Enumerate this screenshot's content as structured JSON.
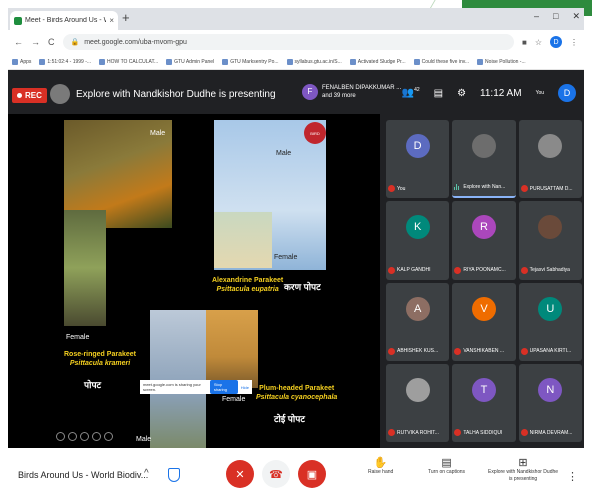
{
  "browser": {
    "tab_title": "Meet - Birds Around Us - W",
    "new_tab": "+",
    "window_controls": [
      "–",
      "□",
      "✕"
    ],
    "url": "meet.google.com/uba-mvom-gpu",
    "bookmarks": [
      "Apps",
      "1:51:02:4 - 1999 -...",
      "HOW TO CALCULAT...",
      "GTU Admin Panel",
      "GTU Marksentry Po...",
      "syllabus.gtu.ac.in/S...",
      "Activated Sludge Pr...",
      "Could these five inv...",
      "Noise Pollution -..."
    ]
  },
  "meet": {
    "rec_label": "REC",
    "presenting_text": "Explore with Nandkishor Dudhe is presenting",
    "others_avatar": "F",
    "others_line1": "FENALBEN DIPAKKUMAR ...",
    "others_line2": "and 39 more",
    "participant_count": "42",
    "time": "11:12 AM",
    "you_avatar": "D",
    "you_label": "You"
  },
  "slide": {
    "logo_text": "BIRD",
    "labels": {
      "male1": "Male",
      "female1": "Female",
      "male2": "Male",
      "female2": "Female",
      "female3": "Female",
      "male3": "Male"
    },
    "captions": {
      "rose_line1": "Rose-ringed Parakeet",
      "rose_line2": "Psittacula krameri",
      "rose_hindi": "पोपट",
      "alex_line1": "Alexandrine Parakeet",
      "alex_line2": "Psittacula eupatria",
      "alex_hindi": "करण पोपट",
      "plum_line1": "Plum-headed Parakeet",
      "plum_line2": "Psittacula cyanocephala",
      "plum_hindi": "टोई पोपट"
    },
    "share_bar": {
      "text": "meet.google.com is sharing your screen.",
      "stop": "Stop sharing",
      "hide": "Hide"
    }
  },
  "participants": [
    {
      "avatar": "D",
      "name": "You",
      "color": "#5c6bc0",
      "mic": "off"
    },
    {
      "avatar": "",
      "name": "Explore with Nan...",
      "color": "#6d6d6d",
      "mic": "on"
    },
    {
      "avatar": "",
      "name": "PURUSATTAM D...",
      "color": "#8a8a8a",
      "mic": "off"
    },
    {
      "avatar": "K",
      "name": "KALP GANDHI",
      "color": "#00897b",
      "mic": "off"
    },
    {
      "avatar": "R",
      "name": "RIYA POONAMC...",
      "color": "#ab47bc",
      "mic": "off"
    },
    {
      "avatar": "",
      "name": "Tejasvi Sabhadiya",
      "color": "#6a4a3a",
      "mic": "off"
    },
    {
      "avatar": "A",
      "name": "ABHISHEK KUS...",
      "color": "#8d6e63",
      "mic": "off"
    },
    {
      "avatar": "V",
      "name": "VANSHIKABEN ...",
      "color": "#ef6c00",
      "mic": "off"
    },
    {
      "avatar": "U",
      "name": "UPASANA KIRTI...",
      "color": "#00897b",
      "mic": "off"
    },
    {
      "avatar": "",
      "name": "RUTVIKA ROHIT...",
      "color": "#9e9e9e",
      "mic": "off"
    },
    {
      "avatar": "T",
      "name": "TALHA SIDDIQUI",
      "color": "#7e57c2",
      "mic": "off"
    },
    {
      "avatar": "N",
      "name": "NIRMA DEVRAM...",
      "color": "#7e57c2",
      "mic": "off"
    }
  ],
  "bottom": {
    "meeting_title": "Birds Around Us - World Biodiv...",
    "chevron": "^",
    "raise_hand": "Raise hand",
    "captions": "Turn on captions",
    "presenting_line1": "Explore with Nandkishor Dudhe",
    "presenting_line2": "is presenting",
    "more": "⋮"
  }
}
